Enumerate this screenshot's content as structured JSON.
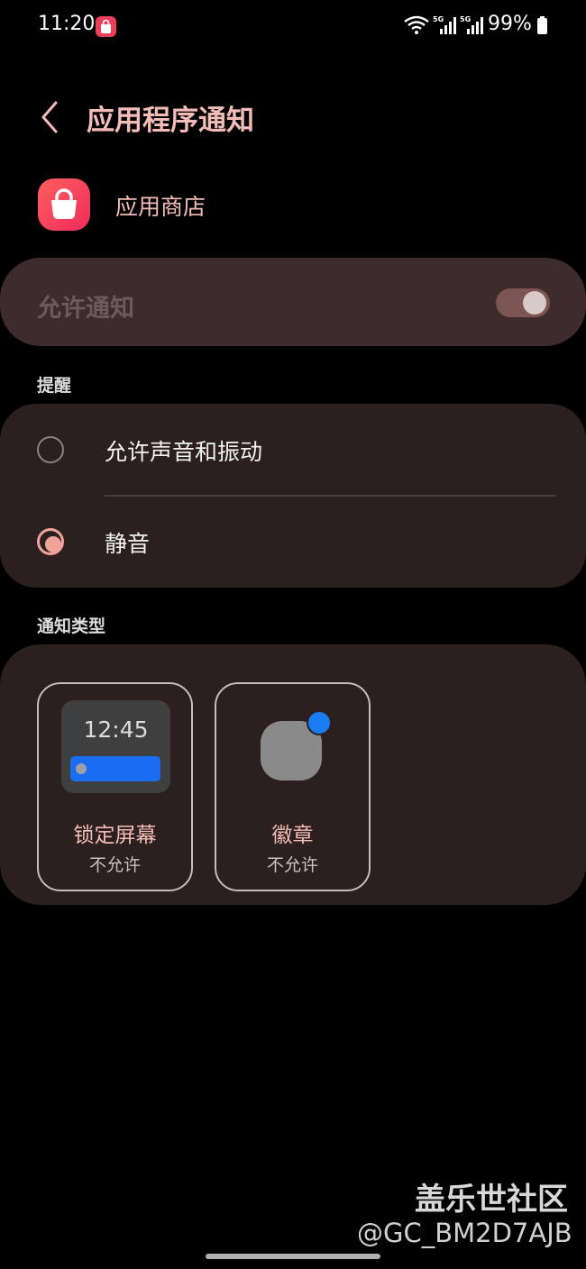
{
  "status_bar": {
    "time": "11:20",
    "battery": "99%",
    "notification_icon": "app-store-bag-icon",
    "network": [
      "wifi-icon",
      "5g-signal-icon",
      "5g-signal-icon"
    ]
  },
  "header": {
    "title": "应用程序通知",
    "back_icon": "chevron-left-icon"
  },
  "app": {
    "name": "应用商店",
    "icon": "shopping-bag-icon"
  },
  "allow_notifications": {
    "label": "允许通知",
    "enabled": true
  },
  "reminder": {
    "heading": "提醒",
    "options": [
      {
        "label": "允许声音和振动",
        "selected": false
      },
      {
        "label": "静音",
        "selected": true
      }
    ]
  },
  "notification_types": {
    "heading": "通知类型",
    "tiles": [
      {
        "name": "锁定屏幕",
        "status": "不允许",
        "preview_time": "12:45"
      },
      {
        "name": "徽章",
        "status": "不允许"
      }
    ]
  },
  "watermark": {
    "site": "盖乐世社区",
    "user": "@GC_BM2D7AJB"
  },
  "colors": {
    "accent": "#f4bcb6",
    "card": "#2b1f20",
    "allow_card": "#3d2b2d",
    "blue": "#1a6cf1"
  }
}
